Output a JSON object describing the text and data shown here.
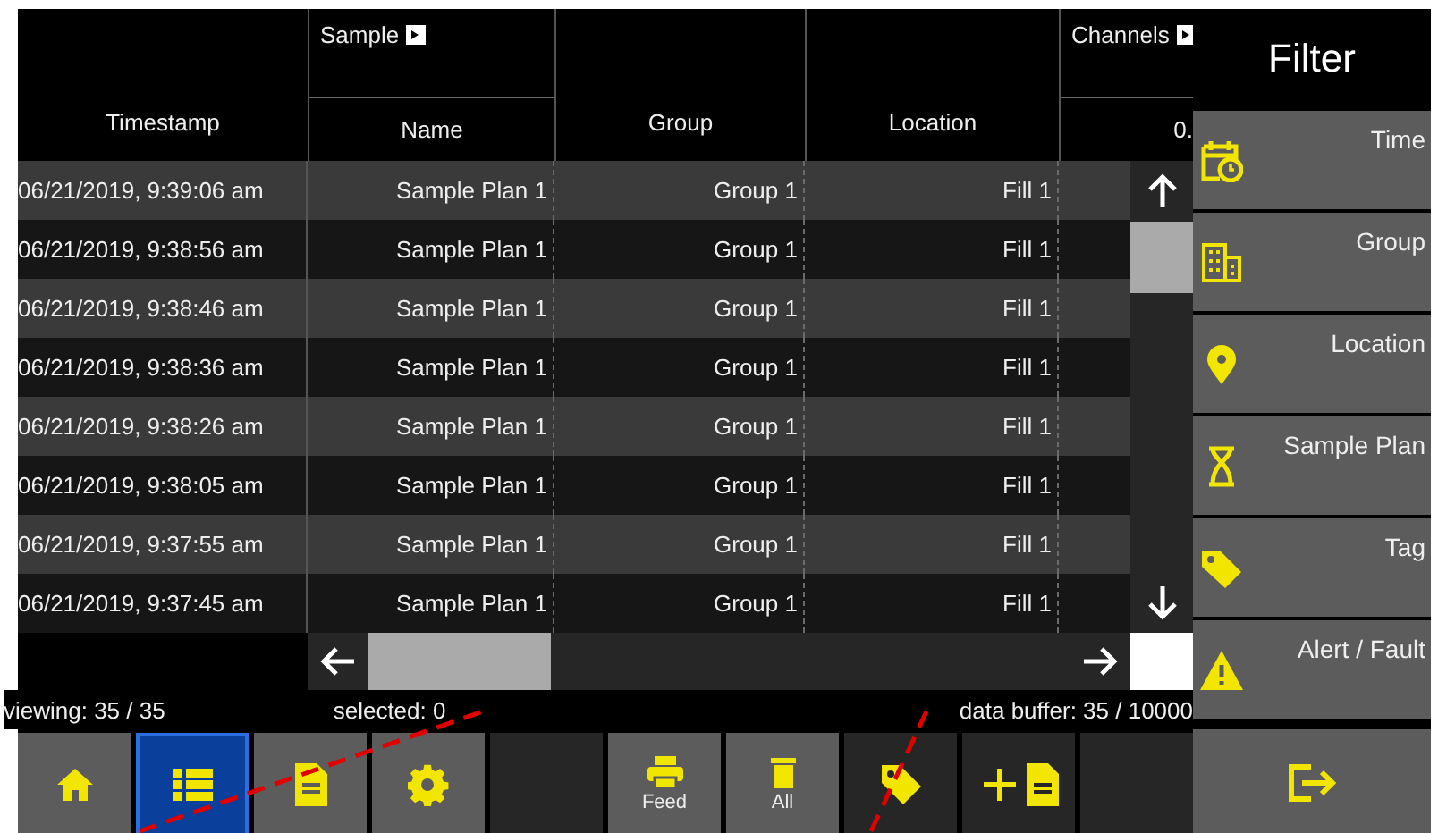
{
  "table": {
    "columns": [
      {
        "label": "Timestamp"
      },
      {
        "group": "Sample",
        "label": "Name"
      },
      {
        "label": "Group"
      },
      {
        "label": "Location"
      },
      {
        "group": "Channels",
        "label": "0."
      }
    ],
    "rows": [
      {
        "timestamp": "06/21/2019, 9:39:06 am",
        "name": "Sample Plan 1",
        "group": "Group 1",
        "location": "Fill 1"
      },
      {
        "timestamp": "06/21/2019, 9:38:56 am",
        "name": "Sample Plan 1",
        "group": "Group 1",
        "location": "Fill 1"
      },
      {
        "timestamp": "06/21/2019, 9:38:46 am",
        "name": "Sample Plan 1",
        "group": "Group 1",
        "location": "Fill 1"
      },
      {
        "timestamp": "06/21/2019, 9:38:36 am",
        "name": "Sample Plan 1",
        "group": "Group 1",
        "location": "Fill 1"
      },
      {
        "timestamp": "06/21/2019, 9:38:26 am",
        "name": "Sample Plan 1",
        "group": "Group 1",
        "location": "Fill 1"
      },
      {
        "timestamp": "06/21/2019, 9:38:05 am",
        "name": "Sample Plan 1",
        "group": "Group 1",
        "location": "Fill 1"
      },
      {
        "timestamp": "06/21/2019, 9:37:55 am",
        "name": "Sample Plan 1",
        "group": "Group 1",
        "location": "Fill 1"
      },
      {
        "timestamp": "06/21/2019, 9:37:45 am",
        "name": "Sample Plan 1",
        "group": "Group 1",
        "location": "Fill 1"
      }
    ]
  },
  "status_bar": {
    "viewing": "viewing: 35 / 35",
    "selected": "selected: 0",
    "buffer": "data buffer: 35 / 10000"
  },
  "toolbar": [
    {
      "kind": "home",
      "selected": false,
      "color": "#5c5c5c"
    },
    {
      "kind": "list",
      "selected": true,
      "color": "#0a3f9c"
    },
    {
      "kind": "document",
      "selected": false,
      "color": "#5c5c5c"
    },
    {
      "kind": "settings",
      "selected": false,
      "color": "#5c5c5c"
    },
    {
      "kind": "empty",
      "selected": false,
      "color": "#262626"
    },
    {
      "kind": "printer",
      "label": "Feed",
      "selected": false,
      "color": "#5c5c5c"
    },
    {
      "kind": "trash",
      "label": "All",
      "selected": false,
      "color": "#5c5c5c"
    },
    {
      "kind": "tag",
      "selected": false,
      "color": "#262626"
    },
    {
      "kind": "add-document",
      "selected": false,
      "color": "#262626"
    },
    {
      "kind": "empty",
      "selected": false,
      "color": "#262626"
    }
  ],
  "filter": {
    "title": "Filter",
    "items": [
      {
        "kind": "time",
        "label": "Time"
      },
      {
        "kind": "group",
        "label": "Group"
      },
      {
        "kind": "location",
        "label": "Location"
      },
      {
        "kind": "sample-plan",
        "label": "Sample Plan"
      },
      {
        "kind": "tag",
        "label": "Tag"
      },
      {
        "kind": "alert",
        "label": "Alert / Fault"
      }
    ],
    "exit": {
      "kind": "exit"
    }
  }
}
